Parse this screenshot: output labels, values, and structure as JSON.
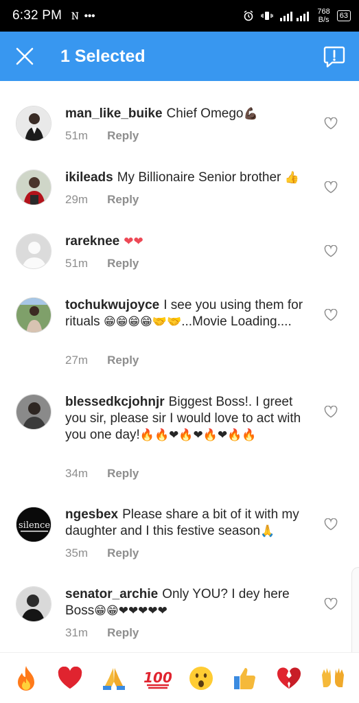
{
  "status_bar": {
    "time": "6:32 PM",
    "network_speed_value": "768",
    "network_speed_unit": "B/s",
    "battery": "63"
  },
  "header": {
    "title": "1 Selected",
    "close_icon": "close-icon",
    "report_icon": "report-icon"
  },
  "comments": [
    {
      "username": "man_like_buike",
      "text": "Chief Omego",
      "emoji": "💪🏿",
      "time": "51m",
      "reply": "Reply"
    },
    {
      "username": "ikileads",
      "text": "My Billionaire Senior brother",
      "emoji": "👍",
      "time": "29m",
      "reply": "Reply"
    },
    {
      "username": "rareknee",
      "text": "",
      "emoji": "❤❤",
      "time": "51m",
      "reply": "Reply"
    },
    {
      "username": "tochukwujoyce",
      "text": "I see you using them for rituals",
      "emoji": "😁😁😁😁🤝🤝",
      "text2": "...Movie Loading....",
      "time": "27m",
      "reply": "Reply"
    },
    {
      "username": "blessedkcjohnjr",
      "text": "Biggest Boss!. I greet you sir, please sir I would love to act with you one day!",
      "emoji": "🔥🔥❤🔥❤🔥❤🔥🔥",
      "time": "34m",
      "reply": "Reply"
    },
    {
      "username": "ngesbex",
      "text": "Please share a bit of it with my daughter and I this festive season",
      "emoji": "🙏",
      "time": "35m",
      "reply": "Reply"
    },
    {
      "username": "senator_archie",
      "text": "Only YOU? I dey here Boss",
      "emoji": "😁😁❤❤❤❤❤",
      "time": "31m",
      "reply": "Reply"
    }
  ],
  "emoji_bar": [
    "🔥",
    "❤",
    "🙏",
    "💯",
    "😮",
    "👍",
    "💔",
    "🙌"
  ],
  "avatar_6_text": "silence",
  "colors": {
    "header_blue": "#3897f0",
    "text": "#262626",
    "meta": "#8e8e8e",
    "heart_red": "#ed4956"
  }
}
